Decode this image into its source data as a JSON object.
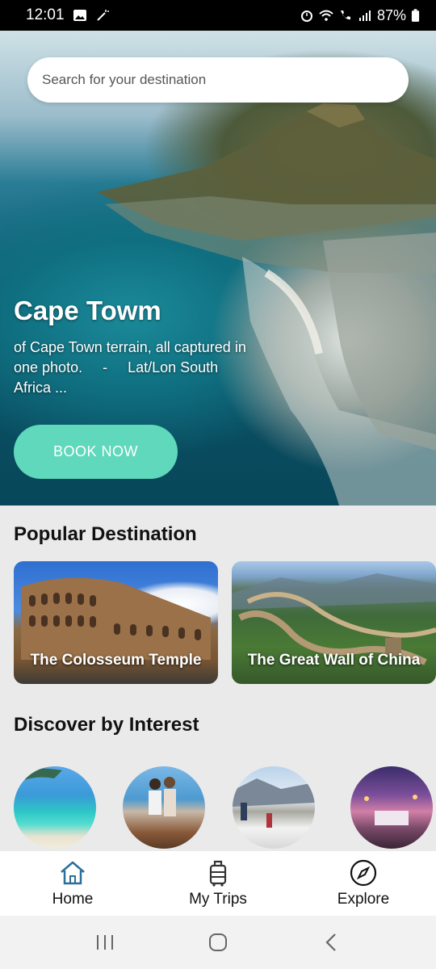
{
  "status_bar": {
    "time": "12:01",
    "battery": "87%"
  },
  "search": {
    "placeholder": "Search for your destination"
  },
  "hero": {
    "title": "Cape Towm",
    "description": "of Cape Town terrain, all captured in one photo.     -     Lat/Lon South Africa ...",
    "book_label": "BOOK NOW"
  },
  "popular": {
    "title": "Popular Destination",
    "items": [
      {
        "label": "The Colosseum Temple"
      },
      {
        "label": "The Great Wall of China"
      }
    ]
  },
  "discover": {
    "title": "Discover by Interest"
  },
  "bottom_nav": {
    "items": [
      {
        "label": "Home",
        "icon": "home-icon"
      },
      {
        "label": "My Trips",
        "icon": "luggage-icon"
      },
      {
        "label": "Explore",
        "icon": "compass-icon"
      }
    ]
  },
  "colors": {
    "accent": "#5fd8bb",
    "home_icon": "#2a6f9a"
  }
}
